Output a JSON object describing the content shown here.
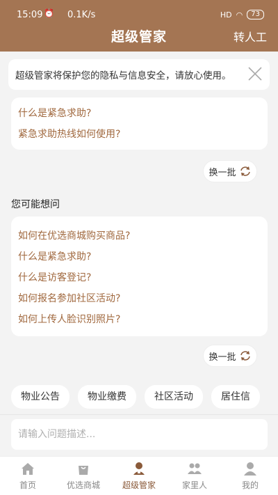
{
  "status_bar": {
    "time": "15:09",
    "speed": "0.1K/s",
    "signal": "HD",
    "battery": "73"
  },
  "header": {
    "title": "超级管家",
    "action": "转人工"
  },
  "notice": {
    "text": "超级管家将保护您的隐私与信息安全，请放心使用。"
  },
  "top_card": {
    "questions": [
      "什么是紧急求助?",
      "紧急求助热线如何使用?"
    ]
  },
  "swap_label": "换一批",
  "suggest": {
    "title": "您可能想问",
    "questions": [
      "如何在优选商城购买商品?",
      "什么是紧急求助?",
      "什么是访客登记?",
      "如何报名参加社区活动?",
      "如何上传人脸识别照片?"
    ]
  },
  "tags": [
    "物业公告",
    "物业缴费",
    "社区活动",
    "居住信"
  ],
  "input": {
    "placeholder": "请输入问题描述..."
  },
  "tabbar": [
    {
      "label": "首页",
      "icon": "home-icon",
      "active": false
    },
    {
      "label": "优选商城",
      "icon": "bag-icon",
      "active": false
    },
    {
      "label": "超级管家",
      "icon": "butler-icon",
      "active": true
    },
    {
      "label": "家里人",
      "icon": "family-icon",
      "active": false
    },
    {
      "label": "我的",
      "icon": "user-icon",
      "active": false
    }
  ],
  "colors": {
    "brand": "#a47553",
    "question_text": "#a0683e",
    "background": "#f3f3f3"
  }
}
